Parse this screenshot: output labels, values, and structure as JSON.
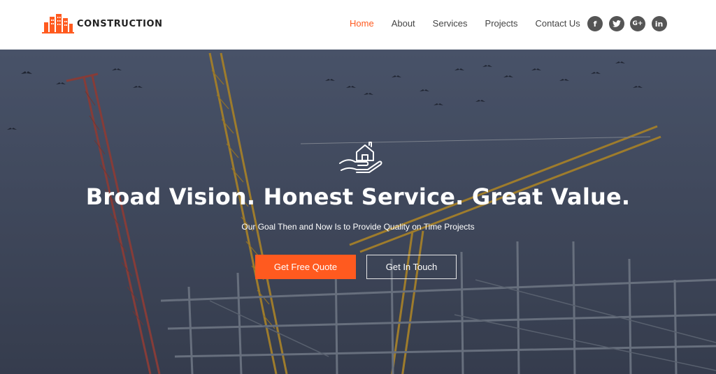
{
  "brand": {
    "name": "CONSTRUCTION",
    "accent_color": "#ff5a1f",
    "logo_icon": "buildings-logo-icon"
  },
  "nav": {
    "items": [
      {
        "label": "Home",
        "active": true
      },
      {
        "label": "About",
        "active": false
      },
      {
        "label": "Services",
        "active": false
      },
      {
        "label": "Projects",
        "active": false
      },
      {
        "label": "Contact Us",
        "active": false
      }
    ]
  },
  "social": [
    {
      "glyph": "f",
      "icon": "facebook-icon"
    },
    {
      "glyph": "t",
      "icon": "twitter-icon"
    },
    {
      "glyph": "G+",
      "icon": "google-plus-icon"
    },
    {
      "glyph": "in",
      "icon": "linkedin-icon"
    }
  ],
  "hero": {
    "icon": "hand-holding-house-icon",
    "title": "Broad Vision. Honest Service. Great Value.",
    "subtitle": "Our Goal Then and Now Is to Provide Quality on Time Projects",
    "primary_button": "Get Free Quote",
    "secondary_button": "Get In Touch",
    "background": "construction-cranes-image"
  }
}
